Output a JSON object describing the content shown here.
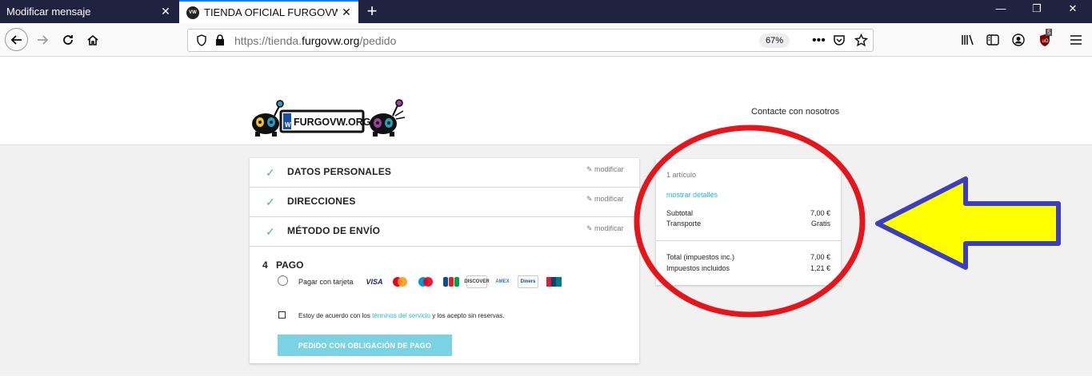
{
  "browser": {
    "tabs": [
      {
        "title": "Modificar mensaje",
        "close": "✕"
      },
      {
        "title": "TIENDA OFICIAL FURGOVW.OR",
        "close": "✕",
        "favicon_text": "VW"
      }
    ],
    "new_tab": "+",
    "window_controls": {
      "minimize": "—",
      "restore": "❐",
      "close": "✕"
    },
    "url_prefix": "https://tienda.",
    "url_domain": "furgovw.org",
    "url_path": "/pedido",
    "zoom": "67%",
    "addon_badge": "5",
    "icons": [
      "back-icon",
      "forward-icon",
      "reload-icon",
      "home-icon",
      "shield-icon",
      "lock-icon",
      "more-icon",
      "pocket-icon",
      "star-icon",
      "library-icon",
      "sidebar-icon",
      "account-icon",
      "ublock-icon",
      "menu-icon"
    ]
  },
  "header": {
    "logo_text": "FURGOVW.ORG",
    "logo_badge": "W",
    "contact": "Contacte con nosotros"
  },
  "checkout": {
    "steps": [
      {
        "label": "DATOS PERSONALES",
        "edit": "modificar"
      },
      {
        "label": "DIRECCIONES",
        "edit": "modificar"
      },
      {
        "label": "MÉTODO DE ENVÍO",
        "edit": "modificar"
      }
    ],
    "payment": {
      "number": "4",
      "label": "PAGO",
      "card_option": "Pagar con tarjeta",
      "cards": [
        "VISA",
        "MC",
        "Maestro",
        "JCB",
        "DISCOVER",
        "AMEX",
        "Diners",
        "UnionPay"
      ],
      "terms_before": "Estoy de acuerdo con los ",
      "terms_link": "términos del servicio",
      "terms_after": " y los acepto sin reservas.",
      "button": "PEDIDO CON OBLIGACIÓN DE PAGO"
    }
  },
  "summary": {
    "items": "1 artículo",
    "show_details": "mostrar detalles",
    "subtotal_label": "Subtotal",
    "subtotal_value": "7,00 €",
    "shipping_label": "Transporte",
    "shipping_value": "Gratis",
    "total_label": "Total (impuestos inc.)",
    "total_value": "7,00 €",
    "taxes_label": "Impuestos incluidos",
    "taxes_value": "1,21 €"
  },
  "colors": {
    "accent": "#24b9d7",
    "check": "#4cbb6c",
    "annotation_circle": "#e8141c",
    "annotation_arrow_fill": "#ffff00",
    "annotation_arrow_stroke": "#3b3fbf"
  }
}
